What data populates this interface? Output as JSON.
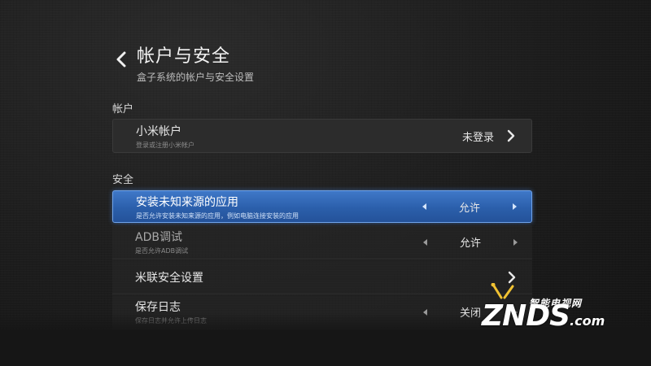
{
  "header": {
    "title": "帐户与安全",
    "subtitle": "盒子系统的帐户与安全设置"
  },
  "sections": {
    "account_label": "帐户",
    "security_label": "安全"
  },
  "account_item": {
    "title": "小米帐户",
    "desc": "登录或注册小米帐户",
    "value": "未登录"
  },
  "security_items": [
    {
      "title": "安装未知来源的应用",
      "desc": "是否允许安装未知来源的应用，例如电脑连接安装的应用",
      "value": "允许"
    },
    {
      "title": "ADB调试",
      "desc": "是否允许ADB调试",
      "value": "允许"
    },
    {
      "title": "米联安全设置"
    },
    {
      "title": "保存日志",
      "desc": "保存日志并允许上传日志",
      "value": "关闭"
    }
  ],
  "watermark": {
    "cn": "智能电视网",
    "logo": "ZNDS",
    "suffix": ".com"
  },
  "colors": {
    "accent": "#3f78c8",
    "background": "#1c1c1c"
  }
}
